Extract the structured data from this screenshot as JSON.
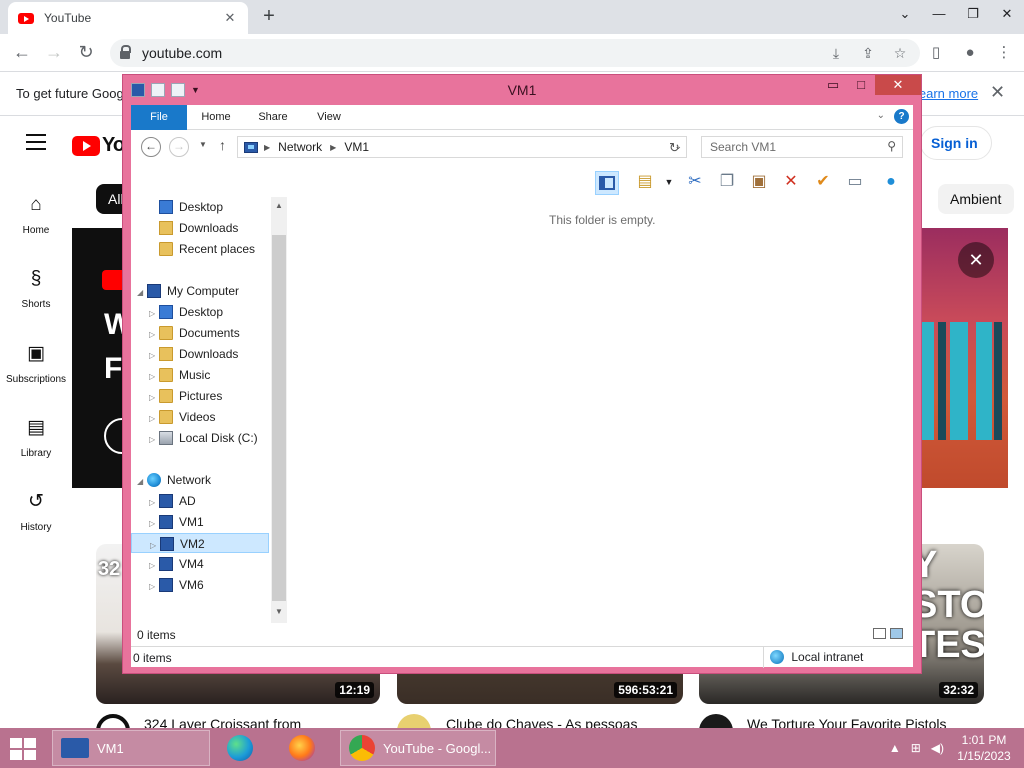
{
  "browser": {
    "tab_title": "YouTube",
    "tab_close": "✕",
    "new_tab": "+",
    "url": "youtube.com",
    "minimize": "⌄",
    "restore": "❐",
    "close": "✕"
  },
  "infobar": {
    "text": "To get future Goog",
    "link": "learn more",
    "close": "✕"
  },
  "youtube": {
    "logo_text": "Yo",
    "sign_in": "Sign in",
    "chip_all": "All",
    "chip_ambient": "Ambient",
    "sidebar": [
      {
        "icon": "⌂",
        "label": "Home"
      },
      {
        "icon": "§",
        "label": "Shorts"
      },
      {
        "icon": "▣",
        "label": "Subscriptions"
      },
      {
        "icon": "▤",
        "label": "Library"
      },
      {
        "icon": "↺",
        "label": "History"
      }
    ],
    "banner_left_line1": "W",
    "banner_left_line2": "F",
    "banner_close": "✕",
    "videos": [
      {
        "thumb_text": "32",
        "duration": "12:19",
        "title": "324 Layer Croissant from"
      },
      {
        "thumb_text": "",
        "duration": "596:53:21",
        "title": "Clube do Chaves - As pessoas"
      },
      {
        "thumb_text": "Y STOL TEST",
        "duration": "32:32",
        "title": "We Torture Your Favorite Pistols"
      }
    ]
  },
  "explorer": {
    "title": "VM1",
    "minimize": "▭",
    "maximize": "□",
    "close": "✕",
    "ribbon_tabs": [
      "File",
      "Home",
      "Share",
      "View"
    ],
    "help": "?",
    "breadcrumb": [
      "Network",
      "VM1"
    ],
    "search_placeholder": "Search VM1",
    "empty_message": "This folder is empty.",
    "nav_tree": [
      {
        "label": "Desktop",
        "icon": "desk",
        "indent": 1,
        "arrow": ""
      },
      {
        "label": "Downloads",
        "icon": "folder-dl",
        "indent": 1,
        "arrow": ""
      },
      {
        "label": "Recent places",
        "icon": "folder",
        "indent": 1,
        "arrow": ""
      },
      {
        "label": "My Computer",
        "icon": "pc",
        "indent": 0,
        "arrow": "◢"
      },
      {
        "label": "Desktop",
        "icon": "desk",
        "indent": 1,
        "arrow": "▷"
      },
      {
        "label": "Documents",
        "icon": "folder",
        "indent": 1,
        "arrow": "▷"
      },
      {
        "label": "Downloads",
        "icon": "folder-dl",
        "indent": 1,
        "arrow": "▷"
      },
      {
        "label": "Music",
        "icon": "folder",
        "indent": 1,
        "arrow": "▷"
      },
      {
        "label": "Pictures",
        "icon": "folder",
        "indent": 1,
        "arrow": "▷"
      },
      {
        "label": "Videos",
        "icon": "folder",
        "indent": 1,
        "arrow": "▷"
      },
      {
        "label": "Local Disk (C:)",
        "icon": "disk",
        "indent": 1,
        "arrow": "▷"
      },
      {
        "label": "Network",
        "icon": "net",
        "indent": 0,
        "arrow": "◢"
      },
      {
        "label": "AD",
        "icon": "pc",
        "indent": 1,
        "arrow": "▷"
      },
      {
        "label": "VM1",
        "icon": "pc",
        "indent": 1,
        "arrow": "▷"
      },
      {
        "label": "VM2",
        "icon": "pc",
        "indent": 1,
        "arrow": "▷",
        "selected": true
      },
      {
        "label": "VM4",
        "icon": "pc",
        "indent": 1,
        "arrow": "▷"
      },
      {
        "label": "VM6",
        "icon": "pc",
        "indent": 1,
        "arrow": "▷"
      }
    ],
    "status_items": "0 items",
    "status_items_bottom": "0 items",
    "zone": "Local intranet"
  },
  "taskbar": {
    "explorer_label": "VM1",
    "chrome_label": "YouTube - Googl...",
    "time": "1:01 PM",
    "date": "1/15/2023"
  },
  "colors": {
    "explorer_frame": "#e8739c",
    "taskbar": "#b9728f",
    "ribbon_file": "#1979ca",
    "selection": "#cde8ff"
  }
}
